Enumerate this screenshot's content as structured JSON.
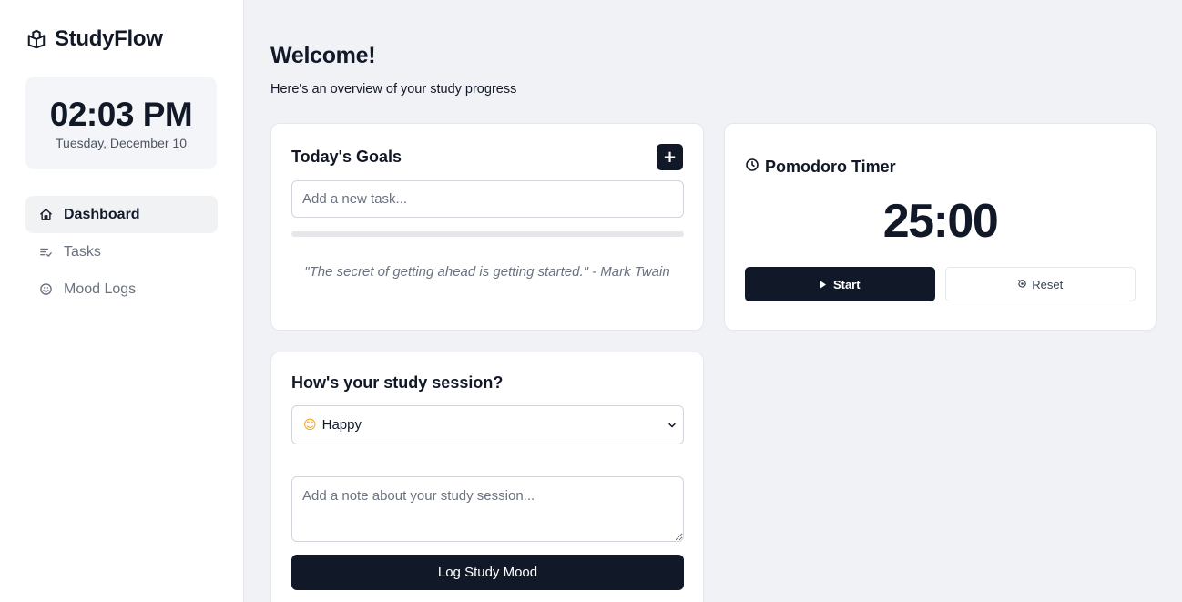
{
  "app": {
    "name": "StudyFlow",
    "logo_icon": "book-open-icon"
  },
  "clock": {
    "time": "02:03 PM",
    "date": "Tuesday, December 10"
  },
  "nav": {
    "items": [
      {
        "label": "Dashboard",
        "icon": "home-icon",
        "active": true
      },
      {
        "label": "Tasks",
        "icon": "list-check-icon",
        "active": false
      },
      {
        "label": "Mood Logs",
        "icon": "smile-icon",
        "active": false
      }
    ]
  },
  "header": {
    "title": "Welcome!",
    "subtitle": "Here's an overview of your study progress"
  },
  "goals": {
    "title": "Today's Goals",
    "add_label": "+",
    "input_placeholder": "Add a new task...",
    "input_value": "",
    "progress": 0,
    "quote": "\"The secret of getting ahead is getting started.\" - Mark Twain"
  },
  "timer": {
    "title": "Pomodoro Timer",
    "icon": "clock-icon",
    "display": "25:00",
    "start_label": "Start",
    "reset_label": "Reset"
  },
  "mood": {
    "title": "How's your study session?",
    "selected_emoji": "😊",
    "selected_label": "Happy",
    "note_placeholder": "Add a note about your study session...",
    "note_value": "",
    "submit_label": "Log Study Mood"
  },
  "colors": {
    "primary": "#111827",
    "background": "#f1f2f6",
    "card": "#ffffff",
    "border": "#e5e7eb",
    "muted_text": "#6b7280"
  }
}
